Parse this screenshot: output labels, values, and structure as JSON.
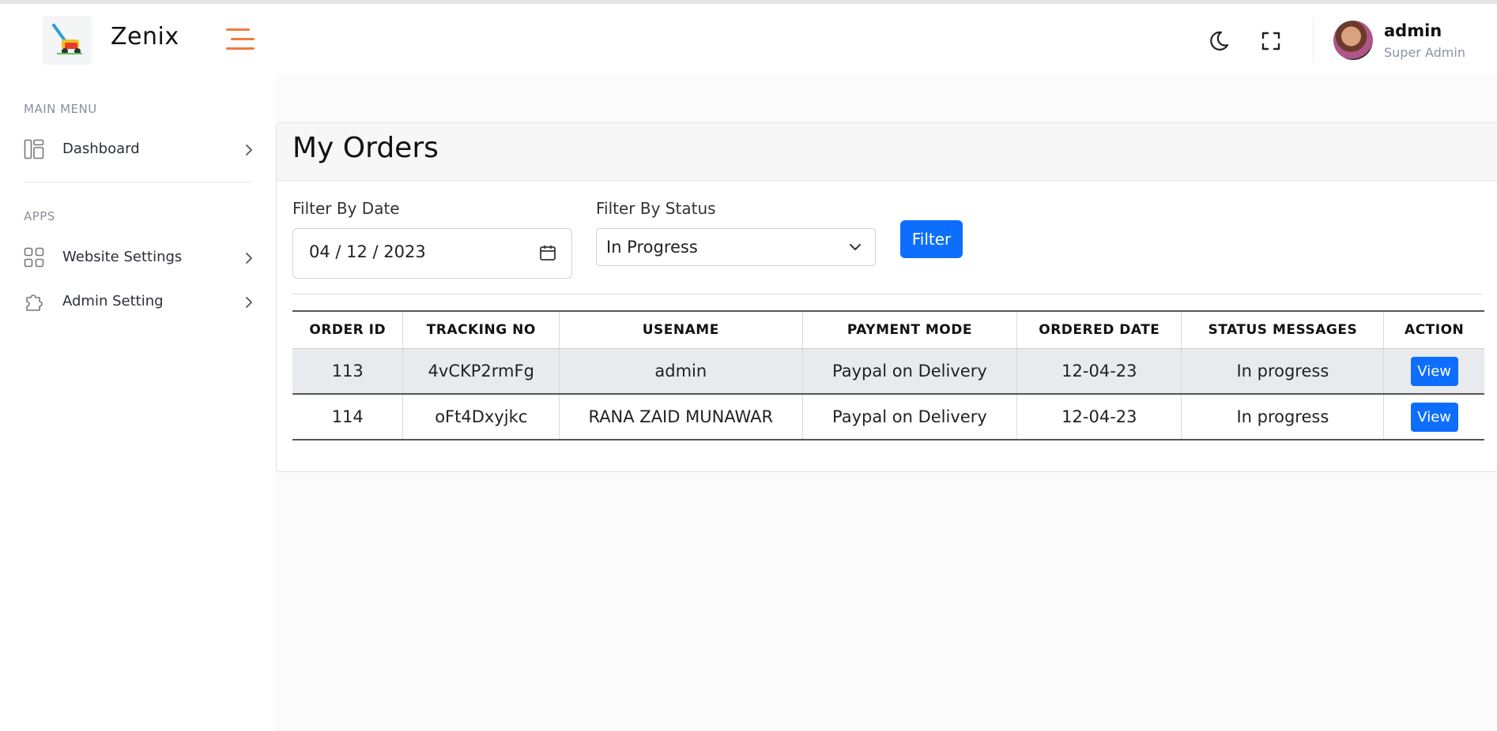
{
  "app": {
    "brand": "Zenix"
  },
  "header": {
    "user_name": "admin",
    "user_role": "Super Admin",
    "icons": [
      "menu-icon",
      "moon-icon",
      "fullscreen-icon"
    ]
  },
  "sidebar": {
    "sections": [
      {
        "title": "MAIN MENU",
        "items": [
          {
            "label": "Dashboard",
            "icon": "dashboard-icon"
          }
        ]
      },
      {
        "title": "APPS",
        "items": [
          {
            "label": "Website Settings",
            "icon": "grid-icon"
          },
          {
            "label": "Admin Setting",
            "icon": "puzzle-icon"
          }
        ]
      }
    ]
  },
  "page": {
    "title": "My Orders",
    "filters": {
      "date_label": "Filter By Date",
      "date_value": "04 / 12 / 2023",
      "status_label": "Filter By Status",
      "status_value": "In Progress",
      "button": "Filter"
    },
    "table": {
      "headers": [
        "ORDER ID",
        "TRACKING NO",
        "USENAME",
        "PAYMENT MODE",
        "ORDERED DATE",
        "STATUS MESSAGES",
        "ACTION"
      ],
      "rows": [
        {
          "order_id": "113",
          "tracking": "4vCKP2rmFg",
          "username": "admin",
          "payment": "Paypal on Delivery",
          "date": "12-04-23",
          "status": "In progress",
          "action": "View"
        },
        {
          "order_id": "114",
          "tracking": "oFt4Dxyjkc",
          "username": "RANA ZAID MUNAWAR",
          "payment": "Paypal on Delivery",
          "date": "12-04-23",
          "status": "In progress",
          "action": "View"
        }
      ]
    }
  },
  "colors": {
    "accent": "#f07b3f",
    "primary": "#0d6efd"
  }
}
